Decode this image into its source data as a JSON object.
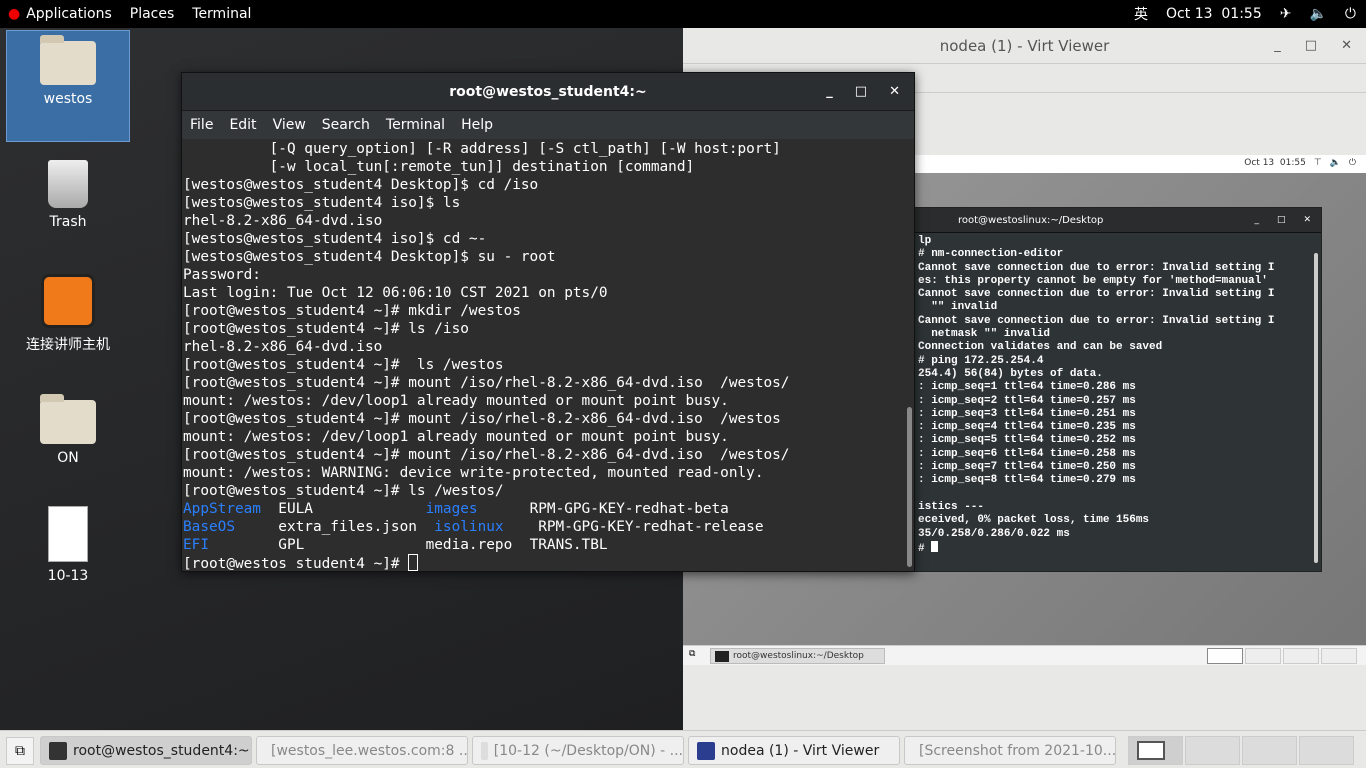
{
  "topbar": {
    "applications": "Applications",
    "places": "Places",
    "terminal": "Terminal",
    "input_method": "英",
    "clock": "Oct 13  01:55",
    "icons": [
      "airplane-icon",
      "volume-icon",
      "power-icon"
    ]
  },
  "desktop_icons": [
    {
      "label": "westos",
      "icon": "home-folder-icon"
    },
    {
      "label": "Trash",
      "icon": "trash-icon"
    },
    {
      "label": "连接讲师主机",
      "icon": "app-launcher-icon"
    },
    {
      "label": "ON",
      "icon": "folder-icon"
    },
    {
      "label": "10-13",
      "icon": "text-file-icon"
    }
  ],
  "terminal": {
    "title": "root@westos_student4:~",
    "menu": [
      "File",
      "Edit",
      "View",
      "Search",
      "Terminal",
      "Help"
    ],
    "lines": [
      "          [-Q query_option] [-R address] [-S ctl_path] [-W host:port]",
      "          [-w local_tun[:remote_tun]] destination [command]",
      "[westos@westos_student4 Desktop]$ cd /iso",
      "[westos@westos_student4 iso]$ ls",
      "rhel-8.2-x86_64-dvd.iso",
      "[westos@westos_student4 iso]$ cd ~-",
      "[westos@westos_student4 Desktop]$ su - root",
      "Password:",
      "Last login: Tue Oct 12 06:06:10 CST 2021 on pts/0",
      "[root@westos_student4 ~]# mkdir /westos",
      "[root@westos_student4 ~]# ls /iso",
      "rhel-8.2-x86_64-dvd.iso",
      "[root@westos_student4 ~]#  ls /westos",
      "[root@westos_student4 ~]# mount /iso/rhel-8.2-x86_64-dvd.iso  /westos/",
      "mount: /westos: /dev/loop1 already mounted or mount point busy.",
      "[root@westos_student4 ~]# mount /iso/rhel-8.2-x86_64-dvd.iso  /westos",
      "mount: /westos: /dev/loop1 already mounted or mount point busy.",
      "[root@westos_student4 ~]# mount /iso/rhel-8.2-x86_64-dvd.iso  /westos/",
      "mount: /westos: WARNING: device write-protected, mounted read-only.",
      "[root@westos_student4 ~]# ls /westos/"
    ],
    "ls_rows": [
      [
        {
          "t": "AppStream",
          "dir": true
        },
        {
          "t": "  EULA             "
        },
        {
          "t": "images",
          "dir": true
        },
        {
          "t": "      RPM-GPG-KEY-redhat-beta"
        }
      ],
      [
        {
          "t": "BaseOS",
          "dir": true
        },
        {
          "t": "     extra_files.json  "
        },
        {
          "t": "isolinux",
          "dir": true
        },
        {
          "t": "    RPM-GPG-KEY-redhat-release"
        }
      ],
      [
        {
          "t": "EFI",
          "dir": true
        },
        {
          "t": "        GPL              "
        },
        {
          "t": "media.repo  TRANS.TBL"
        }
      ]
    ],
    "prompt": "[root@westos_student4 ~]# ",
    "dir_color": "#2a7fff"
  },
  "virt_viewer": {
    "title": "nodea (1) - Virt Viewer",
    "guest_clock": "Oct 13  01:55",
    "guest_terminal": {
      "title": "root@westoslinux:~/Desktop",
      "lines": [
        "lp",
        "# nm-connection-editor",
        "Cannot save connection due to error: Invalid setting I",
        "es: this property cannot be empty for 'method=manual'",
        "Cannot save connection due to error: Invalid setting I",
        "  \"\" invalid",
        "Cannot save connection due to error: Invalid setting I",
        "  netmask \"\" invalid",
        "Connection validates and can be saved",
        "# ping 172.25.254.4",
        "254.4) 56(84) bytes of data.",
        ": icmp_seq=1 ttl=64 time=0.286 ms",
        ": icmp_seq=2 ttl=64 time=0.257 ms",
        ": icmp_seq=3 ttl=64 time=0.251 ms",
        ": icmp_seq=4 ttl=64 time=0.235 ms",
        ": icmp_seq=5 ttl=64 time=0.252 ms",
        ": icmp_seq=6 ttl=64 time=0.258 ms",
        ": icmp_seq=7 ttl=64 time=0.250 ms",
        ": icmp_seq=8 ttl=64 time=0.279 ms",
        "",
        "istics ---",
        "eceived, 0% packet loss, time 156ms",
        "35/0.258/0.286/0.022 ms"
      ],
      "prompt": "# "
    },
    "guest_task": "root@westoslinux:~/Desktop"
  },
  "taskbar": [
    {
      "label": "root@westos_student4:~",
      "active": true
    },
    {
      "label": "[westos_lee.westos.com:8 ...",
      "active": false,
      "minimized": true
    },
    {
      "label": "[10-12 (~/Desktop/ON) - ...",
      "active": false,
      "minimized": true
    },
    {
      "label": "nodea (1) - Virt Viewer",
      "active": false
    },
    {
      "label": "[Screenshot from 2021-10...",
      "active": false,
      "minimized": true
    }
  ]
}
